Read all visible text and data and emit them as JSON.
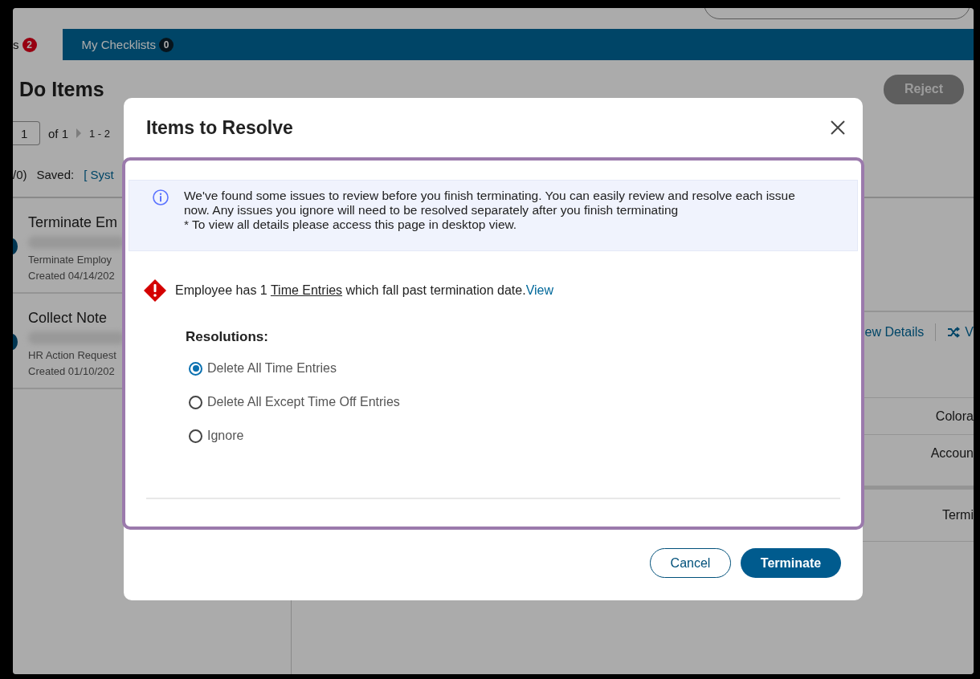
{
  "background": {
    "tabs": [
      {
        "label": "s",
        "badge": "2",
        "selected": true
      },
      {
        "label": "My Checklists",
        "badge": "0",
        "selected": false
      }
    ],
    "heading": "Do Items",
    "pager": {
      "page": "1",
      "of": "of 1",
      "range": "1 - 2"
    },
    "saved": {
      "count": "/0)",
      "label": "Saved:",
      "value": "[ Syst"
    },
    "reject_button": "Reject",
    "tasks": [
      {
        "title": "Terminate Em",
        "subtitle": "Terminate Employ",
        "created": "Created 04/14/202"
      },
      {
        "title": "Collect Note",
        "subtitle": "HR Action Request",
        "created": "Created 01/10/202"
      }
    ],
    "detail": {
      "details_link": "ew Details",
      "compare_link": "V",
      "rows": [
        "Colora",
        "Accoun",
        "Termi"
      ]
    }
  },
  "dialog": {
    "title": "Items to Resolve",
    "notice": {
      "message": "We've found some issues to review before you finish terminating. You can easily review and resolve each issue now. Any issues you ignore will need to be resolved separately after you finish terminating",
      "note": "* To view all details please access this page in desktop view."
    },
    "issue": {
      "prefix": "Employee has 1 ",
      "entries_link": "Time Entries",
      "suffix": " which fall past termination date.",
      "view_link": "View"
    },
    "resolutions": {
      "label": "Resolutions:",
      "options": [
        {
          "label": "Delete All Time Entries",
          "selected": true
        },
        {
          "label": "Delete All Except Time Off Entries",
          "selected": false
        },
        {
          "label": "Ignore",
          "selected": false
        }
      ]
    },
    "buttons": {
      "cancel": "Cancel",
      "confirm": "Terminate"
    }
  }
}
